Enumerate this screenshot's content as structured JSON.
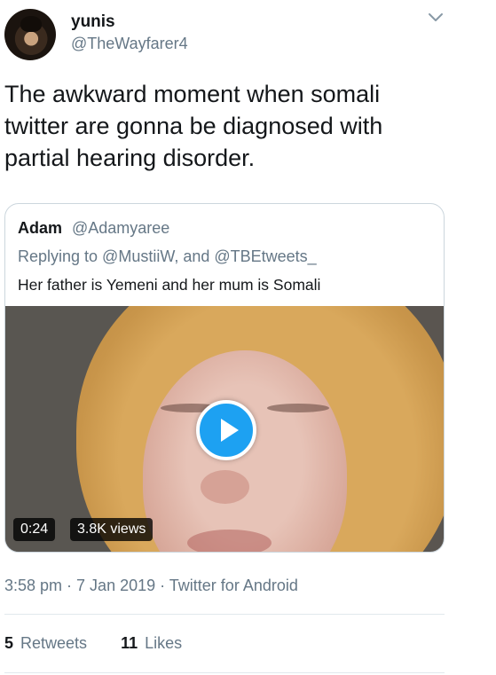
{
  "author": {
    "name": "yunis",
    "handle": "@TheWayfarer4"
  },
  "tweet": {
    "line1": "The awkward moment when somali",
    "line2": "twitter are gonna be diagnosed with",
    "line3": "partial hearing disorder."
  },
  "quoted": {
    "name": "Adam",
    "handle": "@Adamyaree",
    "replying": "Replying to @MustiiW, and @TBEtweets_",
    "text": "Her father is Yemeni and her mum is Somali",
    "video": {
      "duration": "0:24",
      "views": "3.8K views"
    }
  },
  "meta": {
    "time": "3:58 pm",
    "sep1": " · ",
    "date": "7 Jan 2019",
    "sep2": " · ",
    "source": "Twitter for Android"
  },
  "stats": {
    "retweets_count": "5",
    "retweets_label": "Retweets",
    "likes_count": "11",
    "likes_label": "Likes"
  },
  "colors": {
    "accent": "#1da1f2",
    "text": "#14171a",
    "secondary": "#657786",
    "border": "#ccd6dd"
  },
  "icons": {
    "menu": "chevron-down-icon",
    "play": "play-icon"
  }
}
